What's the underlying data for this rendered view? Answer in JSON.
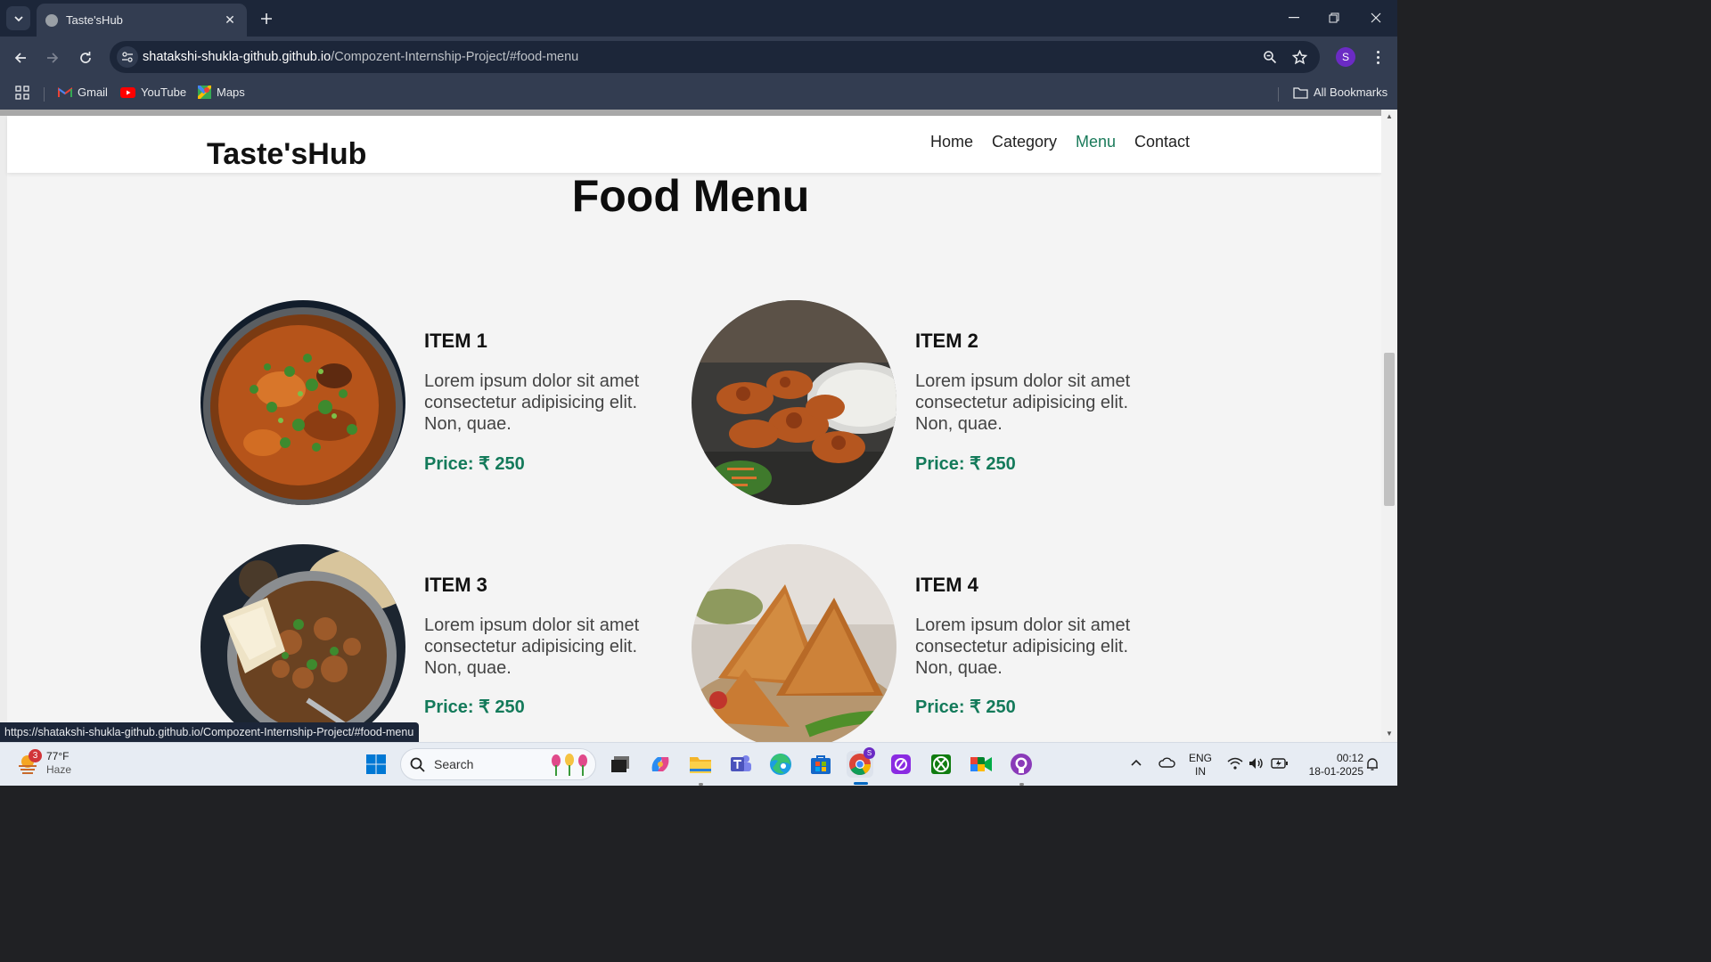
{
  "browser": {
    "tab_title": "Taste'sHub",
    "url_host": "shatakshi-shukla-github.github.io",
    "url_path": "/Compozent-Internship-Project/#food-menu",
    "profile_initial": "S",
    "bookmarks": [
      {
        "label": "Gmail",
        "icon": "gmail-icon"
      },
      {
        "label": "YouTube",
        "icon": "youtube-icon"
      },
      {
        "label": "Maps",
        "icon": "maps-icon"
      }
    ],
    "all_bookmarks_label": "All Bookmarks",
    "status_url": "https://shatakshi-shukla-github.github.io/Compozent-Internship-Project/#food-menu"
  },
  "site": {
    "logo": "Taste'sHub",
    "nav": [
      "Home",
      "Category",
      "Menu",
      "Contact"
    ],
    "active_nav": "Menu",
    "heading": "Food Menu",
    "items": [
      {
        "title": "ITEM 1",
        "desc": "Lorem ipsum dolor sit amet consectetur adipisicing elit. Non, quae.",
        "price": "Price: ₹ 250"
      },
      {
        "title": "ITEM 2",
        "desc": "Lorem ipsum dolor sit amet consectetur adipisicing elit. Non, quae.",
        "price": "Price: ₹ 250"
      },
      {
        "title": "ITEM 3",
        "desc": "Lorem ipsum dolor sit amet consectetur adipisicing elit. Non, quae.",
        "price": "Price: ₹ 250"
      },
      {
        "title": "ITEM 4",
        "desc": "Lorem ipsum dolor sit amet consectetur adipisicing elit. Non, quae.",
        "price": "Price: ₹ 250"
      }
    ]
  },
  "taskbar": {
    "weather_temp": "77°F",
    "weather_cond": "Haze",
    "weather_badge": "3",
    "search_label": "Search",
    "chrome_badge": "S",
    "lang_top": "ENG",
    "lang_bottom": "IN",
    "time": "00:12",
    "date": "18-01-2025"
  },
  "colors": {
    "accent_green": "#137a5a",
    "chrome_dark": "#1c2639",
    "chrome_mid": "#333d51"
  }
}
